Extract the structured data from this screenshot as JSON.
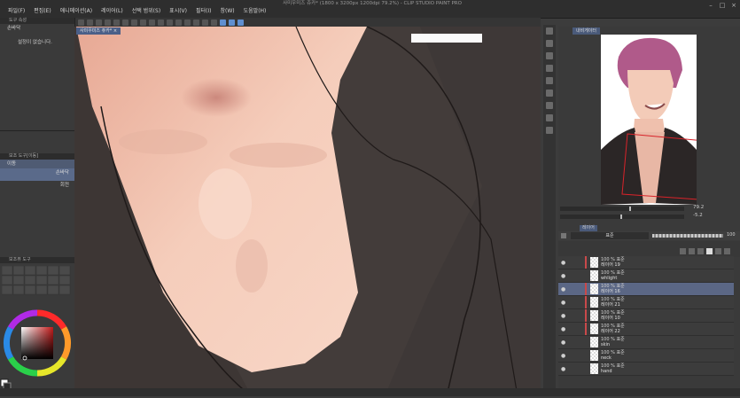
{
  "window": {
    "title": "사미우미즈 쥬카* (1800 x 3200px 1200dpi 79.2%) - CLIP STUDIO PAINT PRO"
  },
  "menu": [
    {
      "label": "파일(F)"
    },
    {
      "label": "편집(E)"
    },
    {
      "label": "애니메이션(A)"
    },
    {
      "label": "레이어(L)"
    },
    {
      "label": "선택 범위(S)"
    },
    {
      "label": "표시(V)"
    },
    {
      "label": "필터(I)"
    },
    {
      "label": "창(W)"
    },
    {
      "label": "도움말(H)"
    }
  ],
  "tool_property": {
    "header": "도구 속성",
    "tool_name": "손바닥",
    "empty_message": "설정이 없습니다."
  },
  "sub_tool": {
    "header": "보조 도구[이동]",
    "items": [
      {
        "label": "이동"
      },
      {
        "label": "손바닥"
      },
      {
        "label": "회전"
      }
    ]
  },
  "color_set": {
    "header": "보조뷰 도구"
  },
  "canvas": {
    "doc_tab": "사미우미즈 쥬카*"
  },
  "navigator": {
    "tab": "내비게이터",
    "zoom": "79.2",
    "rotation": "-5.2"
  },
  "layer_panel": {
    "tab": "레이어",
    "blend_mode": "표준",
    "opacity": "100",
    "layers": [
      {
        "meta": "100 % 표준",
        "name": "레이어 19",
        "selected": false,
        "marked": true
      },
      {
        "meta": "100 % 표준",
        "name": "whlight",
        "selected": false,
        "marked": false
      },
      {
        "meta": "100 % 표준",
        "name": "레이어 16",
        "selected": true,
        "marked": true
      },
      {
        "meta": "100 % 표준",
        "name": "레이어 21",
        "selected": false,
        "marked": true
      },
      {
        "meta": "100 % 표준",
        "name": "레이어 10",
        "selected": false,
        "marked": true
      },
      {
        "meta": "100 % 표준",
        "name": "레이어 22",
        "selected": false,
        "marked": true
      },
      {
        "meta": "100 % 표준",
        "name": "skin",
        "selected": false,
        "marked": false
      },
      {
        "meta": "100 % 표준",
        "name": "neck",
        "selected": false,
        "marked": false
      },
      {
        "meta": "100 % 표준",
        "name": "hand",
        "selected": false,
        "marked": false
      }
    ]
  },
  "colors": {
    "accent": "#5f8fd0",
    "selected_row": "#5b6785",
    "layer_mark": "#c9494a"
  }
}
